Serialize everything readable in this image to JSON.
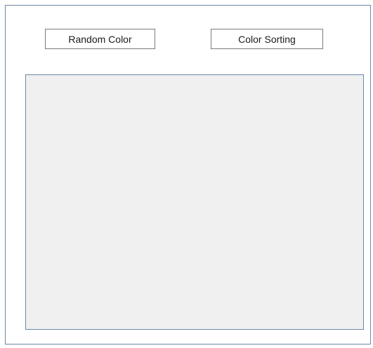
{
  "buttons": {
    "random_color_label": "Random Color",
    "color_sorting_label": "Color Sorting"
  },
  "colors": {
    "window_border": "#6b87a8",
    "panel_background": "#f0f0f0",
    "button_border": "#7a7a7a"
  }
}
